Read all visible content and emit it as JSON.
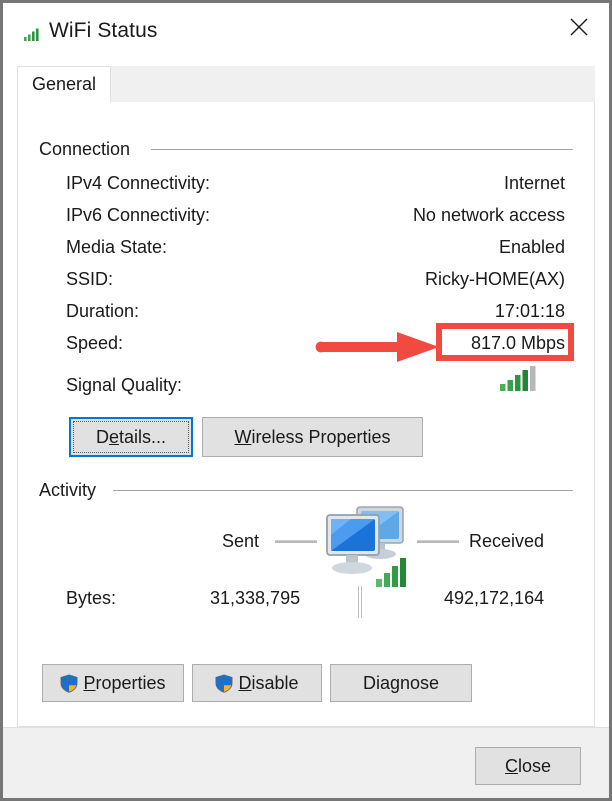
{
  "window": {
    "title": "WiFi Status",
    "title_icon": "wifi-signal-icon",
    "close_icon": "close-icon"
  },
  "tabs": [
    {
      "label": "General",
      "selected": true
    }
  ],
  "connection": {
    "group_label": "Connection",
    "rows": [
      {
        "label": "IPv4 Connectivity:",
        "value": "Internet"
      },
      {
        "label": "IPv6 Connectivity:",
        "value": "No network access"
      },
      {
        "label": "Media State:",
        "value": "Enabled"
      },
      {
        "label": "SSID:",
        "value": "Ricky-HOME(AX)"
      },
      {
        "label": "Duration:",
        "value": "17:01:18"
      },
      {
        "label": "Speed:",
        "value": "817.0 Mbps"
      },
      {
        "label": "Signal Quality:",
        "value": ""
      }
    ],
    "signal_quality_icon": "signal-bars-icon",
    "signal_bars_filled": 4,
    "signal_bars_total": 5,
    "buttons": [
      {
        "label": "Details...",
        "mnemonic": "e",
        "focused": true,
        "shield": false
      },
      {
        "label": "Wireless Properties",
        "mnemonic": "W",
        "focused": false,
        "shield": false
      }
    ]
  },
  "activity": {
    "group_label": "Activity",
    "sent_label": "Sent",
    "received_label": "Received",
    "bytes_label": "Bytes:",
    "bytes_sent": "31,338,795",
    "bytes_received": "492,172,164",
    "monitors_icon": "two-monitors-icon"
  },
  "action_buttons": [
    {
      "label": "Properties",
      "mnemonic": "P",
      "shield": true
    },
    {
      "label": "Disable",
      "mnemonic": "D",
      "shield": true
    },
    {
      "label": "Diagnose",
      "mnemonic": "g",
      "shield": false
    }
  ],
  "footer": {
    "close_label": "Close",
    "close_mnemonic": "C"
  },
  "annotation": {
    "highlight_target": "817.0 Mbps",
    "color": "#f04a41",
    "shape": "rectangle-with-arrow"
  }
}
